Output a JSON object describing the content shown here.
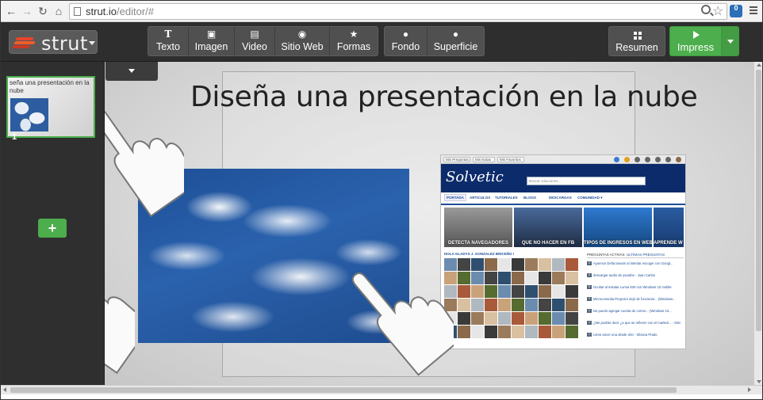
{
  "browser": {
    "url_host": "strut.io",
    "url_path": "/editor/#",
    "ext_badge": "0"
  },
  "brand": {
    "name": "strut"
  },
  "toolbar": {
    "insert": [
      {
        "label": "Texto",
        "icon": "T"
      },
      {
        "label": "Imagen",
        "icon": "▣"
      },
      {
        "label": "Video",
        "icon": "▤"
      },
      {
        "label": "Sitio Web",
        "icon": "◉"
      },
      {
        "label": "Formas",
        "icon": "★"
      }
    ],
    "style": [
      {
        "label": "Fondo",
        "icon": "●"
      },
      {
        "label": "Superficie",
        "icon": "●"
      }
    ],
    "resumen_label": "Resumen",
    "impress_label": "Impress"
  },
  "sidebar": {
    "slides": [
      {
        "number": "1",
        "title": "seña una presentación en la nube"
      }
    ],
    "add_label": "+"
  },
  "slide": {
    "title": "Diseña una presentación en la nube"
  },
  "embedded_site": {
    "top_pills": [
      "Mis Preguntas",
      "Mis Notas",
      "Mis Favoritos"
    ],
    "logo": "Solvetic",
    "search_placeholder": "Buscar soluciones...",
    "nav": [
      "PORTADA",
      "ARTICULOS",
      "TUTORIALES",
      "BLOGS",
      "DESCARGAS",
      "COMUNIDAD ▾"
    ],
    "tiles": [
      "DETECTA NAVEGADORES",
      "QUE NO HACER EN FB",
      "TIPOS DE INGRESOS EN WEB",
      "APRENDE W"
    ],
    "feed_heading": "HOLA GLADYS J. GONZALEZ BRICEÑO !",
    "side_tabs": [
      "PREGUNTAS ACTIVAS",
      "ULTIMAS PREGUNTAS"
    ],
    "questions": [
      {
        "n": "4",
        "text": "Ayuence Delta travars al intentar escoger con Googl...",
        "by": ""
      },
      {
        "n": "0",
        "text": "descargar audio de youtube",
        "by": "Juan Carlos"
      },
      {
        "n": "6",
        "text": "Ocultar al instalar Lumia 530 con Windows 10 mobile",
        "by": ""
      },
      {
        "n": "0",
        "text": "Microcomedia Projector dejó de funcionar... (Windows...",
        "by": ""
      },
      {
        "n": "0",
        "text": "No puedo agregar cuenta de correo... (Windows 10...",
        "by": ""
      },
      {
        "n": "1",
        "text": "¿Me podrás decir ¿a que se refieren con el marketi...",
        "by": "Silvi"
      },
      {
        "n": "1",
        "text": "como ancer una desde oho",
        "by": "Silvana Prado"
      }
    ]
  },
  "colors": {
    "accent_green": "#4cae4c",
    "toolbar_dark": "#2e2e2e",
    "site_blue": "#0c2b6b"
  }
}
